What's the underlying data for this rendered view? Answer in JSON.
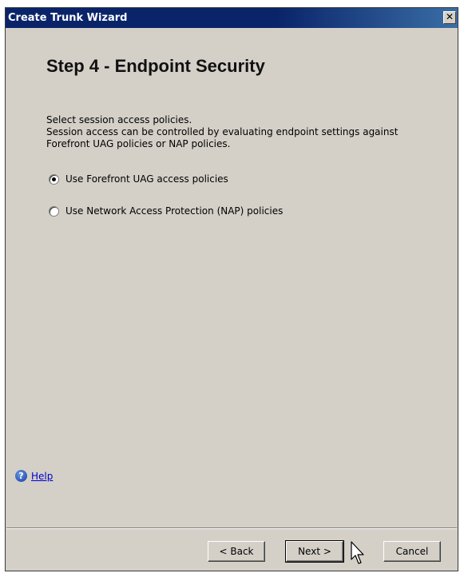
{
  "window": {
    "title": "Create Trunk Wizard",
    "close_glyph": "✕"
  },
  "step": {
    "title": "Step 4 - Endpoint Security"
  },
  "description": {
    "line1": "Select session access policies.",
    "line2": "Session access can be controlled by evaluating endpoint settings against",
    "line3": "Forefront UAG policies or NAP policies."
  },
  "options": [
    {
      "label": "Use Forefront UAG access policies",
      "checked": true
    },
    {
      "label": "Use Network Access Protection (NAP) policies",
      "checked": false
    }
  ],
  "help": {
    "icon": "help-icon",
    "label": "Help"
  },
  "buttons": {
    "back": "< Back",
    "next": "Next >",
    "cancel": "Cancel"
  },
  "colors": {
    "titlebar": "#0a246a",
    "dialog_bg": "#d4d0c8",
    "link": "#0000cc"
  }
}
